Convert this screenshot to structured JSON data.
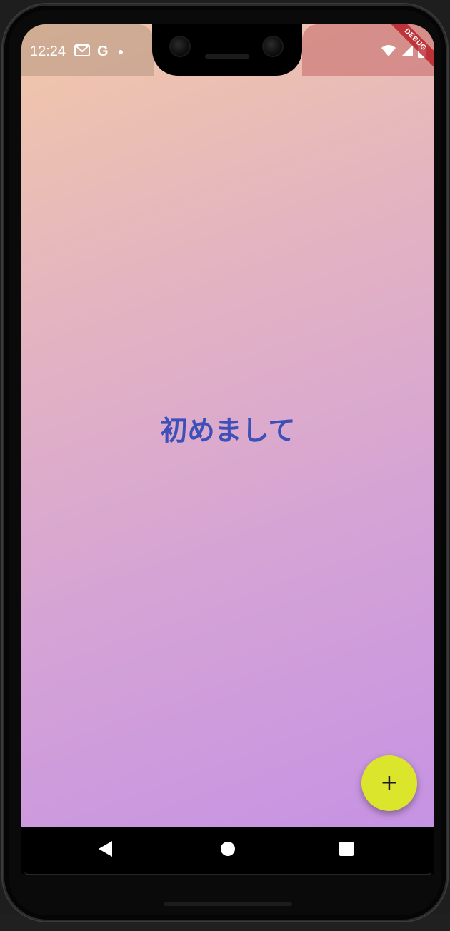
{
  "status_bar": {
    "time": "12:24",
    "left_icons": [
      "gmail-icon",
      "google-g-icon",
      "notification-dot-icon"
    ],
    "g_label": "G",
    "right_icons": [
      "wifi-icon",
      "signal-icon",
      "battery-icon"
    ],
    "debug_banner": "DEBUG"
  },
  "main": {
    "greeting": "初めまして"
  },
  "fab": {
    "icon": "plus-icon",
    "label": "+",
    "color": "#dbe52c"
  },
  "navigation": {
    "buttons": [
      "back-icon",
      "home-icon",
      "recents-icon"
    ]
  },
  "colors": {
    "greeting_text": "#3d4fb8",
    "gradient_top": "#f2c8a8",
    "gradient_bottom": "#c490e6"
  }
}
